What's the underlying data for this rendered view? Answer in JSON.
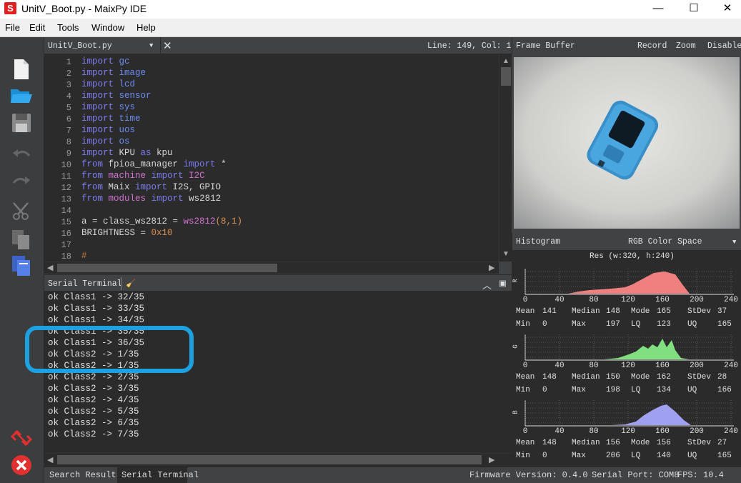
{
  "window": {
    "title": "UnitV_Boot.py - MaixPy IDE",
    "minimize": "—",
    "maximize": "☐",
    "close": "✕"
  },
  "menu": [
    "File",
    "Edit",
    "Tools",
    "Window",
    "Help"
  ],
  "toolbar": {
    "icons": [
      "new-file-icon",
      "open-folder-icon",
      "save-icon",
      "undo-icon",
      "redo-icon",
      "cut-icon",
      "copy-icon",
      "paste-icon",
      "disconnect-icon",
      "stop-icon"
    ]
  },
  "editor": {
    "file_name": "UnitV_Boot.py",
    "position": "Line: 149, Col: 1",
    "lines": [
      {
        "n": "1",
        "html": "<span class=\"kw\">import</span> <span class=\"mod\">gc</span>"
      },
      {
        "n": "2",
        "html": "<span class=\"kw\">import</span> <span class=\"mod\">image</span>"
      },
      {
        "n": "3",
        "html": "<span class=\"kw\">import</span> <span class=\"mod\">lcd</span>"
      },
      {
        "n": "4",
        "html": "<span class=\"kw\">import</span> <span class=\"mod\">sensor</span>"
      },
      {
        "n": "5",
        "html": "<span class=\"kw\">import</span> <span class=\"mod\">sys</span>"
      },
      {
        "n": "6",
        "html": "<span class=\"kw\">import</span> <span class=\"mod\">time</span>"
      },
      {
        "n": "7",
        "html": "<span class=\"kw\">import</span> <span class=\"mod\">uos</span>"
      },
      {
        "n": "8",
        "html": "<span class=\"kw\">import</span> <span class=\"mod\">os</span>"
      },
      {
        "n": "9",
        "html": "<span class=\"kw\">import</span> KPU <span class=\"kw\">as</span> kpu"
      },
      {
        "n": "10",
        "html": "<span class=\"kw\">from</span> fpioa_manager <span class=\"kw\">import</span> *"
      },
      {
        "n": "11",
        "html": "<span class=\"kw\">from</span> <span class=\"pk\">machine</span> <span class=\"kw\">import</span> <span class=\"pk\">I2C</span>"
      },
      {
        "n": "12",
        "html": "<span class=\"kw\">from</span> Maix <span class=\"kw\">import</span> I2S, GPIO"
      },
      {
        "n": "13",
        "html": "<span class=\"kw\">from</span> <span class=\"pk\">modules</span> <span class=\"kw\">import</span> ws2812"
      },
      {
        "n": "14",
        "html": ""
      },
      {
        "n": "15",
        "html": "a = class_ws2812 = <span class=\"pk\">ws2812</span><span class=\"num\">(8,1)</span>"
      },
      {
        "n": "16",
        "html": "BRIGHTNESS = <span class=\"num\">0x10</span>"
      },
      {
        "n": "17",
        "html": ""
      },
      {
        "n": "18",
        "html": "<span class=\"cm\">#</span>"
      }
    ]
  },
  "terminal": {
    "title": "Serial Terminal",
    "lines": [
      "ok Class1 -> 32/35",
      "ok Class1 -> 33/35",
      "ok Class1 -> 34/35",
      "ok Class1 -> 35/35",
      "ok Class1 -> 36/35",
      "ok Class2 -> 1/35",
      "ok Class2 -> 1/35",
      "ok Class2 -> 2/35",
      "ok Class2 -> 3/35",
      "ok Class2 -> 4/35",
      "ok Class2 -> 5/35",
      "ok Class2 -> 6/35",
      "ok Class2 -> 7/35"
    ]
  },
  "status": {
    "tab_search": "Search Results",
    "tab_serial": "Serial Terminal",
    "firmware": "Firmware Version: 0.4.0",
    "port": "Serial Port: COM8",
    "fps": "FPS:  10.4"
  },
  "framebuffer": {
    "title": "Frame Buffer",
    "record": "Record",
    "zoom": "Zoom",
    "disable": "Disable"
  },
  "histogram": {
    "title": "Histogram",
    "color_space": "RGB Color Space",
    "resolution": "Res (w:320, h:240)",
    "ticks": [
      "0",
      "40",
      "80",
      "120",
      "160",
      "200",
      "240"
    ],
    "channels": [
      {
        "label": "R",
        "color": "#f08080",
        "mean": "141",
        "median": "148",
        "mode": "165",
        "stdev": "37",
        "min": "0",
        "max": "197",
        "lq": "123",
        "uq": "165"
      },
      {
        "label": "G",
        "color": "#80e080",
        "mean": "148",
        "median": "150",
        "mode": "162",
        "stdev": "28",
        "min": "0",
        "max": "198",
        "lq": "134",
        "uq": "166"
      },
      {
        "label": "B",
        "color": "#a0a0f0",
        "mean": "148",
        "median": "156",
        "mode": "156",
        "stdev": "27",
        "min": "0",
        "max": "206",
        "lq": "140",
        "uq": "165"
      }
    ],
    "labels": {
      "mean": "Mean",
      "median": "Median",
      "mode": "Mode",
      "stdev": "StDev",
      "min": "Min",
      "max": "Max",
      "lq": "LQ",
      "uq": "UQ"
    }
  }
}
